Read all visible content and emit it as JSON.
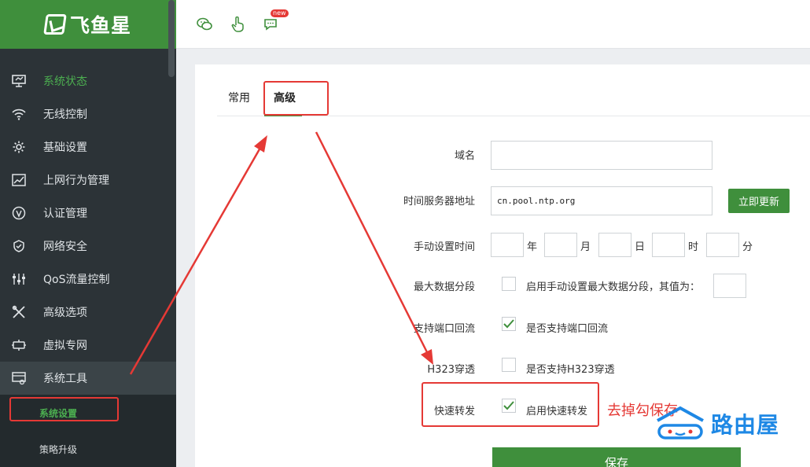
{
  "brand": {
    "name": "飞鱼星"
  },
  "sidebar": {
    "items": [
      {
        "label": "系统状态",
        "icon": "monitor-icon",
        "active": true
      },
      {
        "label": "无线控制",
        "icon": "wifi-icon"
      },
      {
        "label": "基础设置",
        "icon": "gear-icon"
      },
      {
        "label": "上网行为管理",
        "icon": "chart-line-icon"
      },
      {
        "label": "认证管理",
        "icon": "verify-icon"
      },
      {
        "label": "网络安全",
        "icon": "shield-icon"
      },
      {
        "label": "QoS流量控制",
        "icon": "sliders-icon"
      },
      {
        "label": "高级选项",
        "icon": "tools-icon"
      },
      {
        "label": "虚拟专网",
        "icon": "vpn-icon"
      },
      {
        "label": "系统工具",
        "icon": "system-tools-icon",
        "open": true
      }
    ],
    "subitems": [
      {
        "label": "系统设置",
        "active": true
      },
      {
        "label": "策略升级"
      }
    ]
  },
  "topbar": {
    "icons": [
      "wechat-icon",
      "hand-pointer-icon",
      "chat-icon"
    ],
    "badge": "new"
  },
  "tabs": {
    "normal": "常用",
    "advanced": "高级"
  },
  "form": {
    "domain_label": "域名",
    "domain_value": "",
    "ntp_label": "时间服务器地址",
    "ntp_value": "cn.pool.ntp.org",
    "update_button": "立即更新",
    "manual_time_label": "手动设置时间",
    "units": {
      "year": "年",
      "month": "月",
      "day": "日",
      "hour": "时",
      "minute": "分"
    },
    "mss_label": "最大数据分段",
    "mss_text": "启用手动设置最大数据分段，其值为：",
    "mss_checked": false,
    "loopback_label": "支持端口回流",
    "loopback_text": "是否支持端口回流",
    "loopback_checked": true,
    "h323_label": "H323穿透",
    "h323_text": "是否支持H323穿透",
    "h323_checked": false,
    "fast_forward_label": "快速转发",
    "fast_forward_text": "启用快速转发",
    "fast_forward_checked": true,
    "save_button": "保存"
  },
  "annotation": {
    "text": "去掉勾保存",
    "color": "#e53935"
  },
  "watermark": {
    "text": "路由屋",
    "color": "#1e88e5"
  },
  "colors": {
    "accent": "#3f8f3c",
    "sidebar_bg": "#2c3337",
    "active_text": "#4caf50"
  }
}
